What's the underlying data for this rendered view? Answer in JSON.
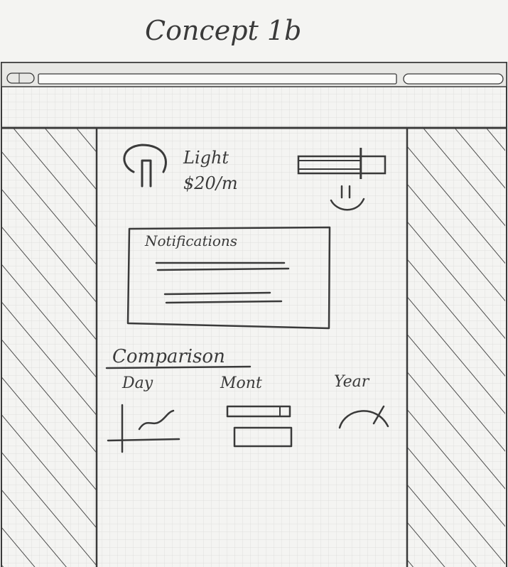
{
  "page_title": "Concept 1b",
  "browser": {
    "url": "",
    "search": ""
  },
  "account": {
    "plan_name": "Light",
    "plan_price": "$20/m",
    "usage_mood_icon": "smiley-icon",
    "usage_level": 0.72
  },
  "notifications": {
    "title": "Notifications"
  },
  "comparison": {
    "title": "Comparison",
    "tabs": [
      {
        "label": "Day",
        "icon": "line-graph-icon"
      },
      {
        "label": "Mont",
        "icon": "bar-graph-icon"
      },
      {
        "label": "Year",
        "icon": "gauge-icon"
      }
    ]
  },
  "colors": {
    "paper": "#f4f4f2",
    "grid": "#d9d9d6",
    "ink": "#3a3a3a"
  }
}
